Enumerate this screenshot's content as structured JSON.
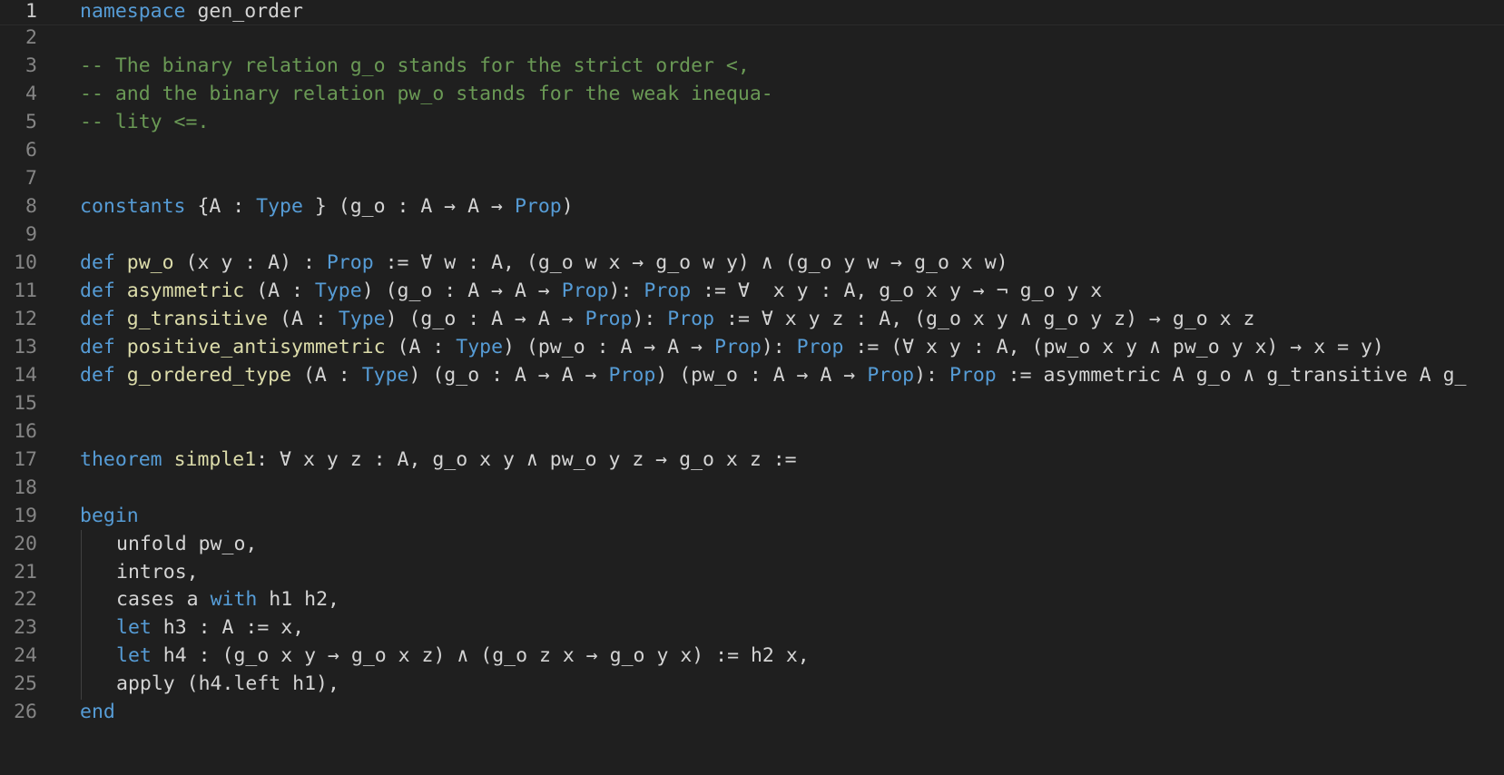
{
  "editor": {
    "language": "lean",
    "colors": {
      "background": "#1f1f1f",
      "keyword": "#569cd6",
      "function": "#dcdcaa",
      "comment": "#6a9955",
      "text": "#d4d4d4",
      "line_number": "#858585"
    },
    "lines": [
      {
        "n": "1",
        "indent": 0,
        "tokens": [
          {
            "t": "namespace",
            "k": "kw"
          },
          {
            "t": " gen_order",
            "k": "id"
          }
        ]
      },
      {
        "n": "2",
        "indent": 0,
        "tokens": []
      },
      {
        "n": "3",
        "indent": 0,
        "tokens": [
          {
            "t": "-- The binary relation g_o stands for the strict order <,",
            "k": "cm"
          }
        ]
      },
      {
        "n": "4",
        "indent": 0,
        "tokens": [
          {
            "t": "-- and the binary relation pw_o stands for the weak inequa-",
            "k": "cm"
          }
        ]
      },
      {
        "n": "5",
        "indent": 0,
        "tokens": [
          {
            "t": "-- lity <=.",
            "k": "cm"
          }
        ]
      },
      {
        "n": "6",
        "indent": 0,
        "tokens": []
      },
      {
        "n": "7",
        "indent": 0,
        "tokens": []
      },
      {
        "n": "8",
        "indent": 0,
        "tokens": [
          {
            "t": "constants",
            "k": "kw"
          },
          {
            "t": " {A : ",
            "k": "id"
          },
          {
            "t": "Type",
            "k": "kw"
          },
          {
            "t": " } (g_o : A → A → ",
            "k": "id"
          },
          {
            "t": "Prop",
            "k": "kw"
          },
          {
            "t": ")",
            "k": "id"
          }
        ]
      },
      {
        "n": "9",
        "indent": 0,
        "tokens": []
      },
      {
        "n": "10",
        "indent": 0,
        "tokens": [
          {
            "t": "def",
            "k": "kw"
          },
          {
            "t": " ",
            "k": "id"
          },
          {
            "t": "pw_o",
            "k": "fn"
          },
          {
            "t": " (x y : A) : ",
            "k": "id"
          },
          {
            "t": "Prop",
            "k": "kw"
          },
          {
            "t": " := ∀ w : A, (g_o w x → g_o w y) ∧ (g_o y w → g_o x w)",
            "k": "id"
          }
        ]
      },
      {
        "n": "11",
        "indent": 0,
        "tokens": [
          {
            "t": "def",
            "k": "kw"
          },
          {
            "t": " ",
            "k": "id"
          },
          {
            "t": "asymmetric",
            "k": "fn"
          },
          {
            "t": " (A : ",
            "k": "id"
          },
          {
            "t": "Type",
            "k": "kw"
          },
          {
            "t": ") (g_o : A → A → ",
            "k": "id"
          },
          {
            "t": "Prop",
            "k": "kw"
          },
          {
            "t": "): ",
            "k": "id"
          },
          {
            "t": "Prop",
            "k": "kw"
          },
          {
            "t": " := ∀  x y : A, g_o x y → ¬ g_o y x",
            "k": "id"
          }
        ]
      },
      {
        "n": "12",
        "indent": 0,
        "tokens": [
          {
            "t": "def",
            "k": "kw"
          },
          {
            "t": " ",
            "k": "id"
          },
          {
            "t": "g_transitive",
            "k": "fn"
          },
          {
            "t": " (A : ",
            "k": "id"
          },
          {
            "t": "Type",
            "k": "kw"
          },
          {
            "t": ") (g_o : A → A → ",
            "k": "id"
          },
          {
            "t": "Prop",
            "k": "kw"
          },
          {
            "t": "): ",
            "k": "id"
          },
          {
            "t": "Prop",
            "k": "kw"
          },
          {
            "t": " := ∀ x y z : A, (g_o x y ∧ g_o y z) → g_o x z",
            "k": "id"
          }
        ]
      },
      {
        "n": "13",
        "indent": 0,
        "tokens": [
          {
            "t": "def",
            "k": "kw"
          },
          {
            "t": " ",
            "k": "id"
          },
          {
            "t": "positive_antisymmetric",
            "k": "fn"
          },
          {
            "t": " (A : ",
            "k": "id"
          },
          {
            "t": "Type",
            "k": "kw"
          },
          {
            "t": ") (pw_o : A → A → ",
            "k": "id"
          },
          {
            "t": "Prop",
            "k": "kw"
          },
          {
            "t": "): ",
            "k": "id"
          },
          {
            "t": "Prop",
            "k": "kw"
          },
          {
            "t": " := (∀ x y : A, (pw_o x y ∧ pw_o y x) → x = y)",
            "k": "id"
          }
        ]
      },
      {
        "n": "14",
        "indent": 0,
        "tokens": [
          {
            "t": "def",
            "k": "kw"
          },
          {
            "t": " ",
            "k": "id"
          },
          {
            "t": "g_ordered_type",
            "k": "fn"
          },
          {
            "t": " (A : ",
            "k": "id"
          },
          {
            "t": "Type",
            "k": "kw"
          },
          {
            "t": ") (g_o : A → A → ",
            "k": "id"
          },
          {
            "t": "Prop",
            "k": "kw"
          },
          {
            "t": ") (pw_o : A → A → ",
            "k": "id"
          },
          {
            "t": "Prop",
            "k": "kw"
          },
          {
            "t": "): ",
            "k": "id"
          },
          {
            "t": "Prop",
            "k": "kw"
          },
          {
            "t": " := asymmetric A g_o ∧ g_transitive A g_",
            "k": "id"
          }
        ]
      },
      {
        "n": "15",
        "indent": 0,
        "tokens": []
      },
      {
        "n": "16",
        "indent": 0,
        "tokens": []
      },
      {
        "n": "17",
        "indent": 0,
        "tokens": [
          {
            "t": "theorem",
            "k": "kw"
          },
          {
            "t": " ",
            "k": "id"
          },
          {
            "t": "simple1",
            "k": "fn"
          },
          {
            "t": ": ∀ x y z : A, g_o x y ∧ pw_o y z → g_o x z :=",
            "k": "id"
          }
        ]
      },
      {
        "n": "18",
        "indent": 0,
        "tokens": []
      },
      {
        "n": "19",
        "indent": 0,
        "tokens": [
          {
            "t": "begin",
            "k": "kw"
          }
        ]
      },
      {
        "n": "20",
        "indent": 1,
        "tokens": [
          {
            "t": "unfold pw_o,",
            "k": "id"
          }
        ]
      },
      {
        "n": "21",
        "indent": 1,
        "tokens": [
          {
            "t": "intros,",
            "k": "id"
          }
        ]
      },
      {
        "n": "22",
        "indent": 1,
        "tokens": [
          {
            "t": "cases a ",
            "k": "id"
          },
          {
            "t": "with",
            "k": "kw"
          },
          {
            "t": " h1 h2,",
            "k": "id"
          }
        ]
      },
      {
        "n": "23",
        "indent": 1,
        "tokens": [
          {
            "t": "let",
            "k": "kw"
          },
          {
            "t": " h3 : A := x,",
            "k": "id"
          }
        ]
      },
      {
        "n": "24",
        "indent": 1,
        "tokens": [
          {
            "t": "let",
            "k": "kw"
          },
          {
            "t": " h4 : (g_o x y → g_o x z) ∧ (g_o z x → g_o y x) := h2 x,",
            "k": "id"
          }
        ]
      },
      {
        "n": "25",
        "indent": 1,
        "tokens": [
          {
            "t": "apply (h4.left h1),",
            "k": "id"
          }
        ]
      },
      {
        "n": "26",
        "indent": 0,
        "tokens": [
          {
            "t": "end",
            "k": "kw"
          }
        ]
      }
    ]
  }
}
